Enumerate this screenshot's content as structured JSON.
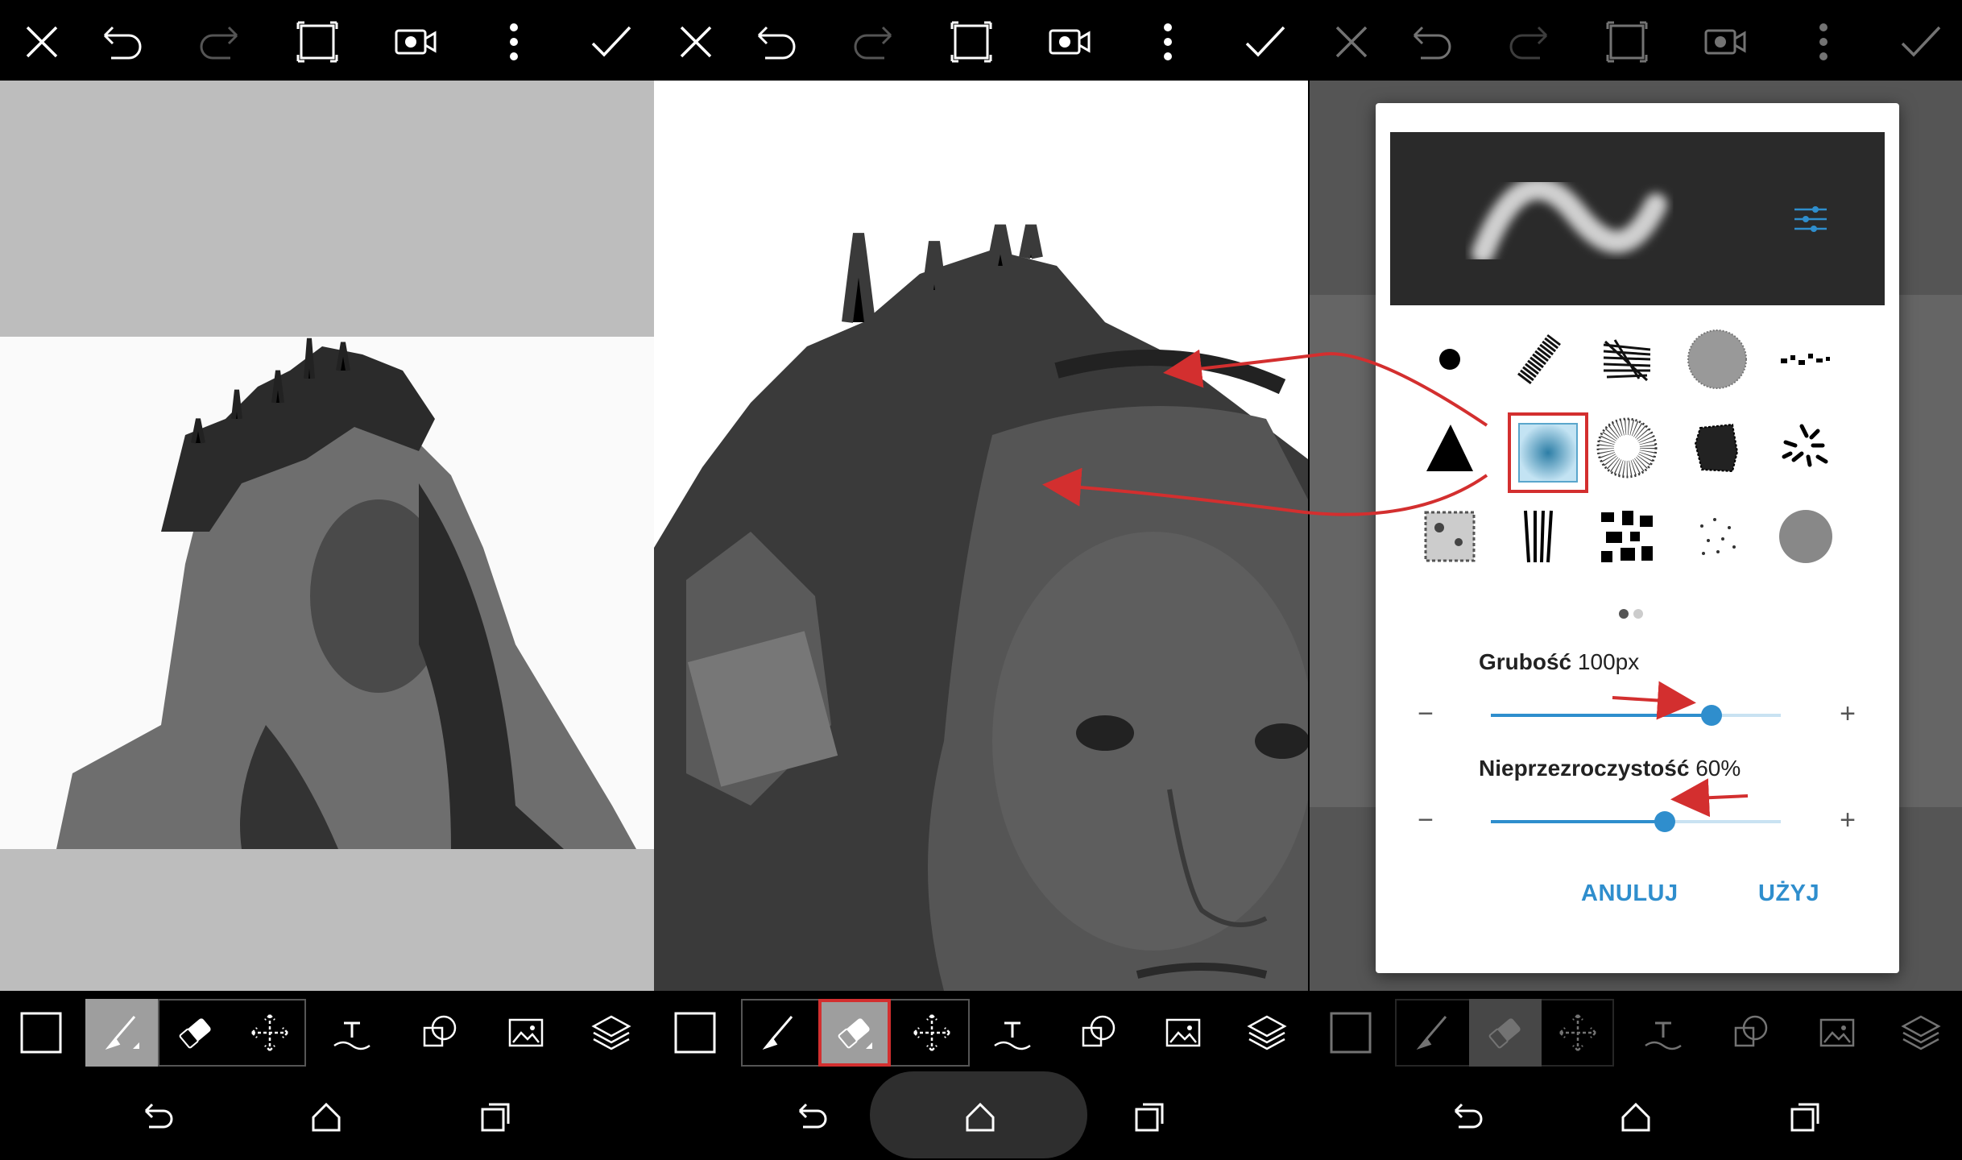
{
  "colors": {
    "accent": "#2f8ecd",
    "highlight_box": "#d32f2f",
    "toolbar_bg": "#000000",
    "canvas_grey": "#bdbdbd"
  },
  "top_bar_icons": [
    "close-icon",
    "undo-icon",
    "redo-icon",
    "crop-frame-icon",
    "video-record-icon",
    "more-vertical-icon",
    "check-icon"
  ],
  "bottom_tools": [
    "color-swatch",
    "brush-icon",
    "eraser-icon",
    "move-icon",
    "text-icon",
    "shape-icon",
    "image-icon",
    "layers-icon"
  ],
  "nav_icons": [
    "back-icon",
    "home-icon",
    "recents-icon"
  ],
  "brush_dialog": {
    "brush_presets": [
      "dot",
      "chalk",
      "scribble",
      "noise-circle",
      "dashes",
      "triangle",
      "soft-blur",
      "speckle-circle",
      "rough-blot",
      "splatter",
      "grunge-square",
      "stripes",
      "camo",
      "sparse-dots",
      "grey-circle"
    ],
    "selected_brush": "soft-blur",
    "page_dots": 2,
    "active_page": 1,
    "thickness": {
      "label": "Grubość",
      "value_text": "100px",
      "fraction": 0.76
    },
    "opacity": {
      "label": "Nieprzezroczystość",
      "value_text": "60%",
      "fraction": 0.6
    },
    "minus": "−",
    "plus": "+",
    "cancel_label": "ANULUJ",
    "apply_label": "UŻYJ"
  }
}
